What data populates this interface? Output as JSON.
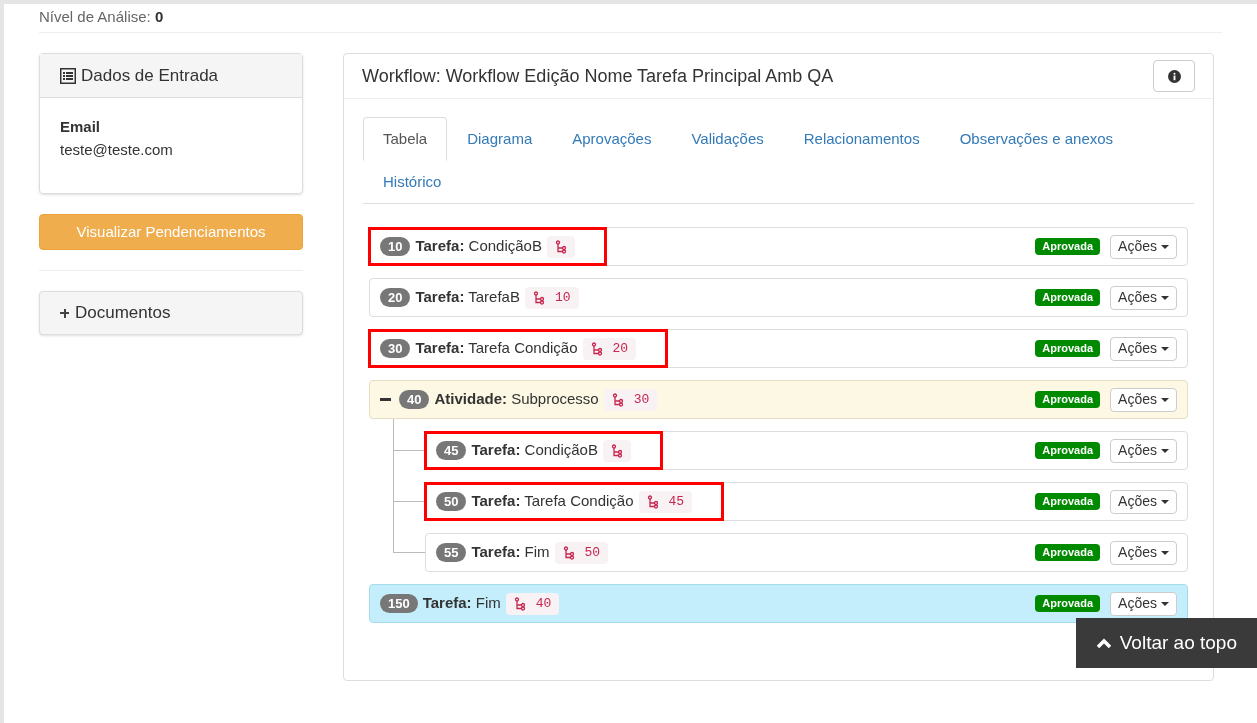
{
  "analysis_level": {
    "label": "Nível de Análise:",
    "value": "0"
  },
  "input_panel": {
    "title": "Dados de Entrada",
    "field_label": "Email",
    "field_value": "teste@teste.com"
  },
  "pending_button": "Visualizar Pendenciamentos",
  "documents_panel": {
    "title": "Documentos",
    "expanded": false
  },
  "workflow": {
    "title": "Workflow: Workflow Edição Nome Tarefa Principal Amb QA",
    "tabs": [
      {
        "label": "Tabela",
        "selected": true
      },
      {
        "label": "Diagrama",
        "selected": false
      },
      {
        "label": "Aprovações",
        "selected": false
      },
      {
        "label": "Validações",
        "selected": false
      },
      {
        "label": "Relacionamentos",
        "selected": false
      },
      {
        "label": "Observações e anexos",
        "selected": false
      },
      {
        "label": "Histórico",
        "selected": false
      }
    ],
    "rows": [
      {
        "kind": "task",
        "number": "10",
        "text": "**Tarefa:** CondiçãoB",
        "status": "Aprovada",
        "action": "Ações",
        "highlighted": true
      },
      {
        "kind": "task",
        "number": "20",
        "text": "**Tarefa:** TarefaB",
        "ref": "10",
        "status": "Aprovada",
        "action": "Ações",
        "highlighted": false
      },
      {
        "kind": "task",
        "number": "30",
        "text": "**Tarefa:** Tarefa Condição",
        "ref": "20",
        "status": "Aprovada",
        "action": "Ações",
        "highlighted": true
      },
      {
        "kind": "activity",
        "number": "40",
        "text": "**Atividade:** Subprocesso",
        "ref": "30",
        "status": "Aprovada",
        "action": "Ações",
        "highlighted": false,
        "expanded": true,
        "children": [
          {
            "kind": "task",
            "number": "45",
            "text": "**Tarefa:** CondiçãoB",
            "status": "Aprovada",
            "action": "Ações",
            "highlighted": true
          },
          {
            "kind": "task",
            "number": "50",
            "text": "**Tarefa:** Tarefa Condição",
            "ref": "45",
            "status": "Aprovada",
            "action": "Ações",
            "highlighted": true
          },
          {
            "kind": "task",
            "number": "55",
            "text": "**Tarefa:** Fim",
            "ref": "50",
            "status": "Aprovada",
            "action": "Ações",
            "highlighted": false
          }
        ]
      },
      {
        "kind": "final",
        "number": "150",
        "text": "**Tarefa:** Fim",
        "ref": "40",
        "status": "Aprovada",
        "action": "Ações",
        "highlighted": false
      }
    ]
  },
  "back_to_top": "Voltar ao topo"
}
